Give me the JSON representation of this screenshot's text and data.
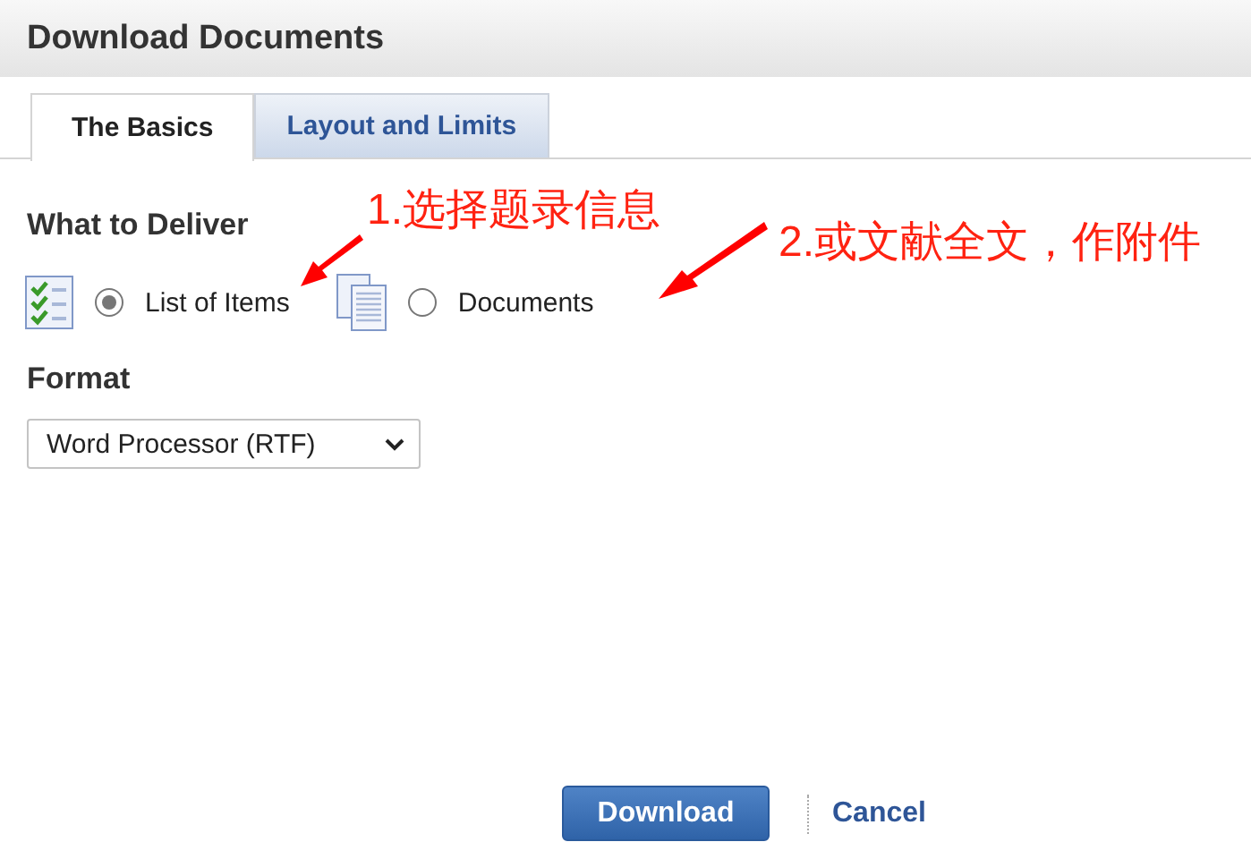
{
  "window": {
    "title": "Download Documents"
  },
  "tabs": [
    {
      "label": "The Basics",
      "selected": true
    },
    {
      "label": "Layout and Limits",
      "selected": false
    }
  ],
  "deliver": {
    "heading": "What to Deliver",
    "options": [
      {
        "kind": "list",
        "label": "List of Items",
        "selected": true
      },
      {
        "kind": "documents",
        "label": "Documents",
        "selected": false
      }
    ]
  },
  "format": {
    "heading": "Format",
    "value": "Word Processor (RTF)"
  },
  "buttons": {
    "primary": "Download",
    "secondary": "Cancel"
  },
  "annotations": [
    {
      "text": "1.选择题录信息"
    },
    {
      "text": "2.或文献全文，作附件"
    }
  ]
}
